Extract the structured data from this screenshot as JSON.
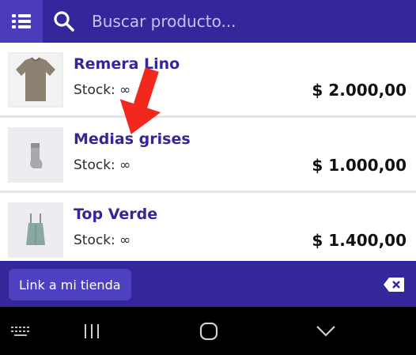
{
  "search": {
    "placeholder": "Buscar producto..."
  },
  "products": [
    {
      "name": "Remera Lino",
      "stock": "Stock: ∞",
      "price": "$ 2.000,00"
    },
    {
      "name": "Medias grises",
      "stock": "Stock: ∞",
      "price": "$ 1.000,00"
    },
    {
      "name": "Top Verde",
      "stock": "Stock: ∞",
      "price": "$ 1.400,00"
    }
  ],
  "footer": {
    "store_link_label": "Link a mi tienda"
  },
  "colors": {
    "primary": "#34269b",
    "primary_light": "#4d41c0",
    "annotation_arrow": "#f2281e"
  },
  "icons": {
    "menu": "list-icon",
    "search": "search-icon",
    "backspace": "backspace-icon",
    "keyboard": "keyboard-icon",
    "recents": "recents-icon",
    "home": "home-icon",
    "back": "back-chevron-icon"
  }
}
